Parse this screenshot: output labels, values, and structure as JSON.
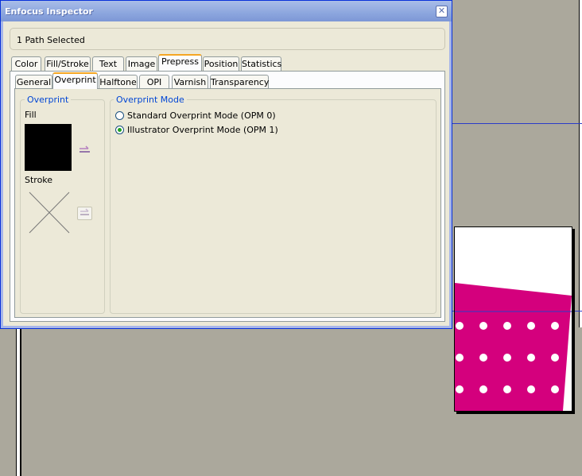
{
  "window": {
    "title": "Enfocus Inspector",
    "close_glyph": "✕"
  },
  "status": {
    "selection_text": "1 Path Selected"
  },
  "main_tabs": [
    {
      "label": "Color",
      "active": false
    },
    {
      "label": "Fill/Stroke",
      "active": false
    },
    {
      "label": "Text",
      "active": false
    },
    {
      "label": "Image",
      "active": false
    },
    {
      "label": "Prepress",
      "active": true
    },
    {
      "label": "Position",
      "active": false
    },
    {
      "label": "Statistics",
      "active": false
    }
  ],
  "sub_tabs": [
    {
      "label": "General",
      "active": false
    },
    {
      "label": "Overprint",
      "active": true
    },
    {
      "label": "Halftone",
      "active": false
    },
    {
      "label": "OPI",
      "active": false
    },
    {
      "label": "Varnish",
      "active": false
    },
    {
      "label": "Transparency",
      "active": false
    }
  ],
  "overprint_group": {
    "title": "Overprint",
    "fill_label": "Fill",
    "stroke_label": "Stroke",
    "fill_color": "#000000",
    "stroke_color": "none",
    "fill_overprint_icon": "swap-icon",
    "stroke_overprint_icon": "swap-icon"
  },
  "overprint_mode": {
    "title": "Overprint Mode",
    "options": [
      {
        "label": "Standard Overprint Mode (OPM 0)",
        "selected": false
      },
      {
        "label": "Illustrator Overprint Mode (OPM 1)",
        "selected": true
      }
    ]
  },
  "colors": {
    "accent": "#0046d5",
    "artwork_magenta": "#d4007d",
    "active_tab": "#f5a623"
  }
}
